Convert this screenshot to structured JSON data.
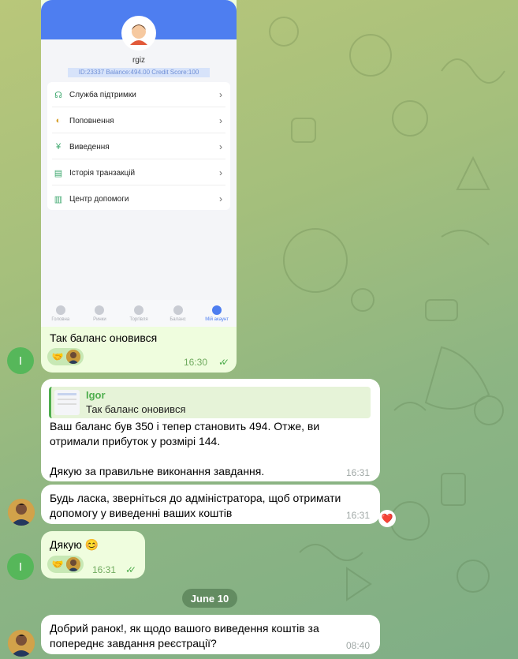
{
  "phone": {
    "username": "rgiz",
    "info": "ID:23337  Balance:494.00  Credit Score:100",
    "menu": [
      {
        "label": "Служба підтримки",
        "icon": "headset-icon"
      },
      {
        "label": "Поповнення",
        "icon": "wallet-icon"
      },
      {
        "label": "Виведення",
        "icon": "withdraw-icon"
      },
      {
        "label": "Історія транзакцій",
        "icon": "document-icon"
      },
      {
        "label": "Центр допомоги",
        "icon": "book-icon"
      }
    ],
    "tabs": [
      {
        "label": "Головна",
        "icon": "home-icon"
      },
      {
        "label": "Ринки",
        "icon": "market-icon"
      },
      {
        "label": "Торгівля",
        "icon": "trade-icon"
      },
      {
        "label": "Баланс",
        "icon": "balance-icon"
      },
      {
        "label": "Мій акаунт",
        "icon": "account-icon",
        "active": true
      }
    ]
  },
  "messages": [
    {
      "sender": "out",
      "text": "Так баланс оновився",
      "time": "16:30",
      "read": true
    },
    {
      "sender": "in",
      "reply_name": "Igor",
      "reply_text": "Так баланс оновився",
      "text": "Ваш баланс був 350 і тепер становить 494. Отже, ви отримали прибуток у розмірі 144.\n\nДякую за правильне виконання завдання.",
      "time": "16:31"
    },
    {
      "sender": "in",
      "text": "Будь ласка, зверніться до адміністратора, щоб отримати допомогу у виведенні ваших коштів",
      "time": "16:31",
      "reaction": "❤️"
    },
    {
      "sender": "out",
      "text": "Дякую 😊",
      "time": "16:31",
      "read": true
    },
    {
      "sender": "in",
      "text": "Добрий ранок!, як щодо вашого виведення коштів за попереднє завдання реєстрації?",
      "time": "08:40"
    }
  ],
  "date_separator": "June 10",
  "user_initial": "I",
  "colors": {
    "accent": "#4fae4e",
    "out_bubble": "#effdde",
    "phone_header": "#4e7ef0"
  }
}
